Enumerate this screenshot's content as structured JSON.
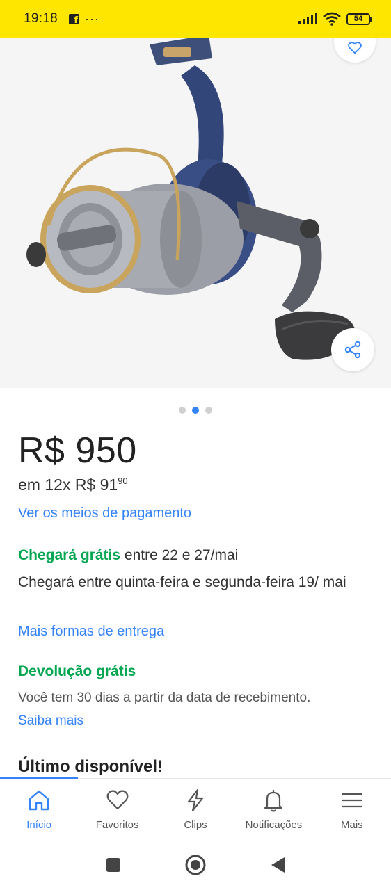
{
  "status_bar": {
    "time": "19:18",
    "dots": "···",
    "battery": "54"
  },
  "gallery": {
    "page_count": 3,
    "active_index": 1
  },
  "product": {
    "price": "R$ 950",
    "installments_prefix": "em 12x R$ 91",
    "installments_cents": "90",
    "payment_link": "Ver os meios de pagamento"
  },
  "shipping": {
    "free_label": "Chegará grátis",
    "range": " entre 22 e 27/mai",
    "detail": "Chegará entre quinta-feira e segunda-feira 19/ mai",
    "more_link": "Mais formas de entrega"
  },
  "returns": {
    "title": "Devolução grátis",
    "text": "Você tem 30 dias a partir da data de recebimento.",
    "link": "Saiba mais"
  },
  "stock": {
    "label": "Último disponível!"
  },
  "bottom_nav": {
    "items": [
      {
        "label": "Início",
        "icon": "home-icon",
        "active": true
      },
      {
        "label": "Favoritos",
        "icon": "heart-icon",
        "active": false
      },
      {
        "label": "Clips",
        "icon": "lightning-icon",
        "active": false
      },
      {
        "label": "Notificações",
        "icon": "bell-icon",
        "active": false
      },
      {
        "label": "Mais",
        "icon": "menu-icon",
        "active": false
      }
    ]
  },
  "colors": {
    "brand_yellow": "#ffe600",
    "link_blue": "#3483fa",
    "green": "#00a650"
  }
}
